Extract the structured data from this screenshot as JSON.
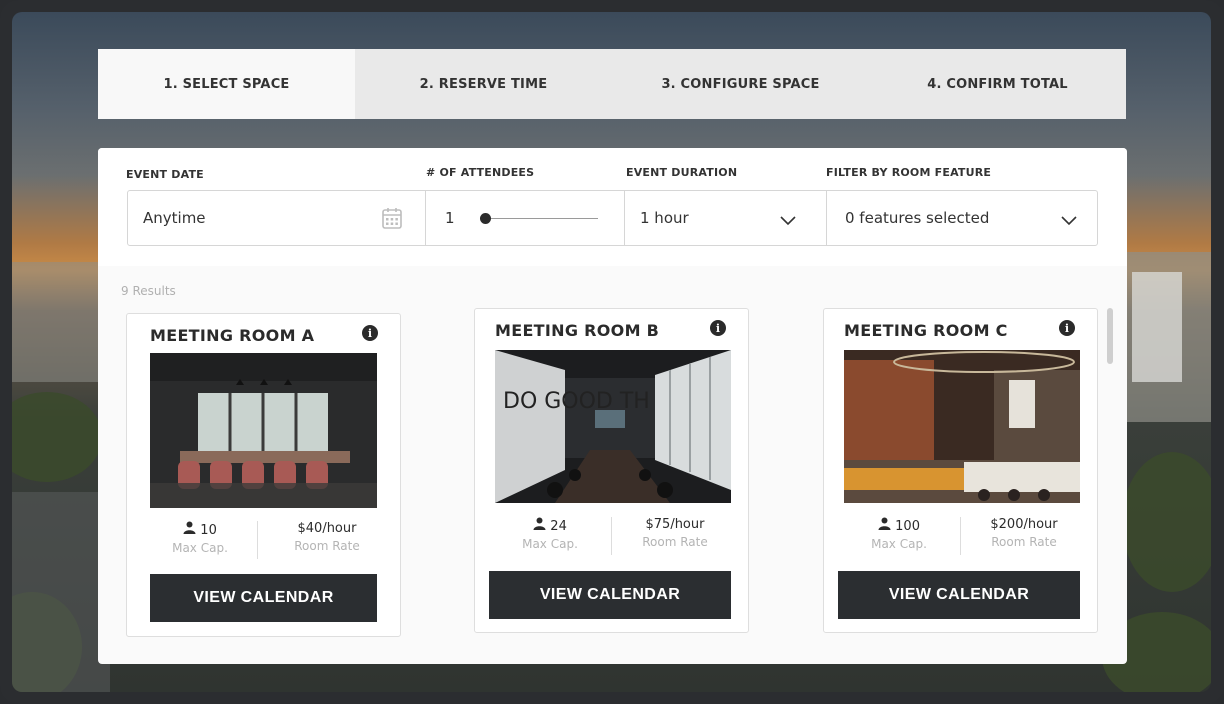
{
  "steps": [
    {
      "label": "1. SELECT SPACE",
      "active": true
    },
    {
      "label": "2. RESERVE TIME",
      "active": false
    },
    {
      "label": "3. CONFIGURE SPACE",
      "active": false
    },
    {
      "label": "4. CONFIRM TOTAL",
      "active": false
    }
  ],
  "filters": {
    "event_date_label": "EVENT DATE",
    "event_date_value": "Anytime",
    "attendees_label": "# OF ATTENDEES",
    "attendees_value": "1",
    "attendees_slider": 0,
    "duration_label": "EVENT DURATION",
    "duration_value": "1 hour",
    "feature_label": "FILTER BY ROOM FEATURE",
    "feature_value": "0 features selected"
  },
  "results_text": "9 Results",
  "rooms": [
    {
      "name": "MEETING ROOM A",
      "capacity": "10",
      "capacity_label": "Max Cap.",
      "rate": "$40/hour",
      "rate_label": "Room Rate",
      "button": "VIEW CALENDAR"
    },
    {
      "name": "MEETING ROOM B",
      "capacity": "24",
      "capacity_label": "Max Cap.",
      "rate": "$75/hour",
      "rate_label": "Room Rate",
      "button": "VIEW CALENDAR"
    },
    {
      "name": "MEETING ROOM C",
      "capacity": "100",
      "capacity_label": "Max Cap.",
      "rate": "$200/hour",
      "rate_label": "Room Rate",
      "button": "VIEW CALENDAR"
    }
  ],
  "room_b_photo_text": "DO GOOD TH",
  "icons": [
    "calendar-icon",
    "chevron-down-icon",
    "info-icon",
    "person-icon"
  ],
  "colors": {
    "button": "#2b2e31",
    "step_bar": "#e9e9e9",
    "active_step": "#f8f8f8"
  }
}
